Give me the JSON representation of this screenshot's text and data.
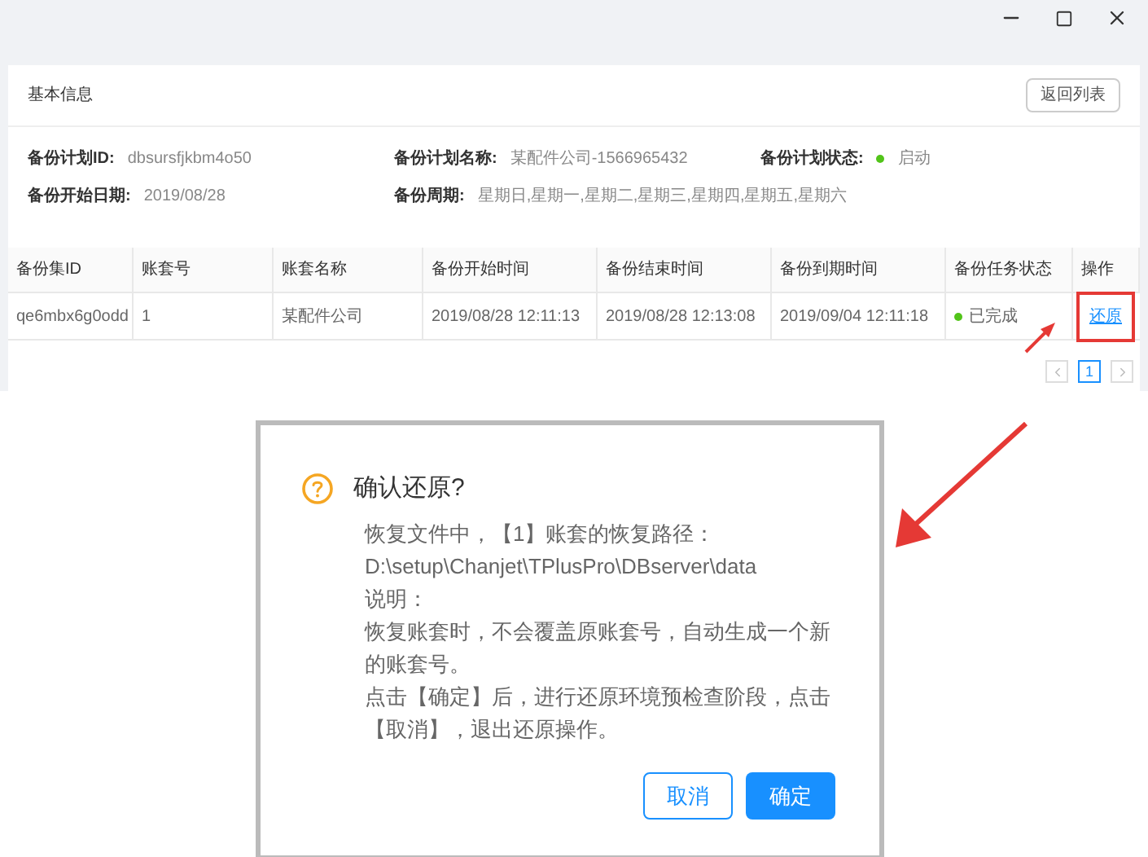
{
  "section": {
    "title": "基本信息",
    "back_button": "返回列表"
  },
  "info": [
    {
      "label": "备份计划ID:",
      "value": "dbsursfjkbm4o50"
    },
    {
      "label": "备份计划名称:",
      "value": "某配件公司-1566965432"
    },
    {
      "label": "备份计划状态:",
      "value": "启动",
      "color": "#52c41a"
    },
    {
      "label": "备份开始日期:",
      "value": "2019/08/28"
    },
    {
      "label": "备份周期:",
      "value": "星期日,星期一,星期二,星期三,星期四,星期五,星期六"
    }
  ],
  "table": {
    "columns": [
      "备份集ID",
      "账套号",
      "账套名称",
      "备份开始时间",
      "备份结束时间",
      "备份到期时间",
      "备份任务状态",
      "操作"
    ],
    "rows": [
      {
        "cells": [
          "qe6mbx6g0odd",
          "1",
          "某配件公司",
          "2019/08/28 12:11:13",
          "2019/08/28 12:13:08",
          "2019/09/04 12:11:18"
        ],
        "status": "已完成",
        "color": "#52c41a",
        "action": "还原"
      }
    ]
  },
  "pagination": {
    "pages": [
      {
        "label": "1",
        "selected": true
      }
    ]
  },
  "dialog": {
    "title": "确认还原?",
    "lines": [
      "恢复文件中，【1】账套的恢复路径：",
      "D:\\setup\\Chanjet\\TPlusPro\\DBserver\\data",
      "说明：",
      "恢复账套时，不会覆盖原账套号，自动生成一个新的账套号。",
      "点击【确定】后，进行还原环境预检查阶段，点击【取消】，退出还原操作。"
    ],
    "buttons": [
      {
        "label": "取消",
        "kind": "secondary"
      },
      {
        "label": "确定",
        "kind": "primary"
      }
    ]
  }
}
